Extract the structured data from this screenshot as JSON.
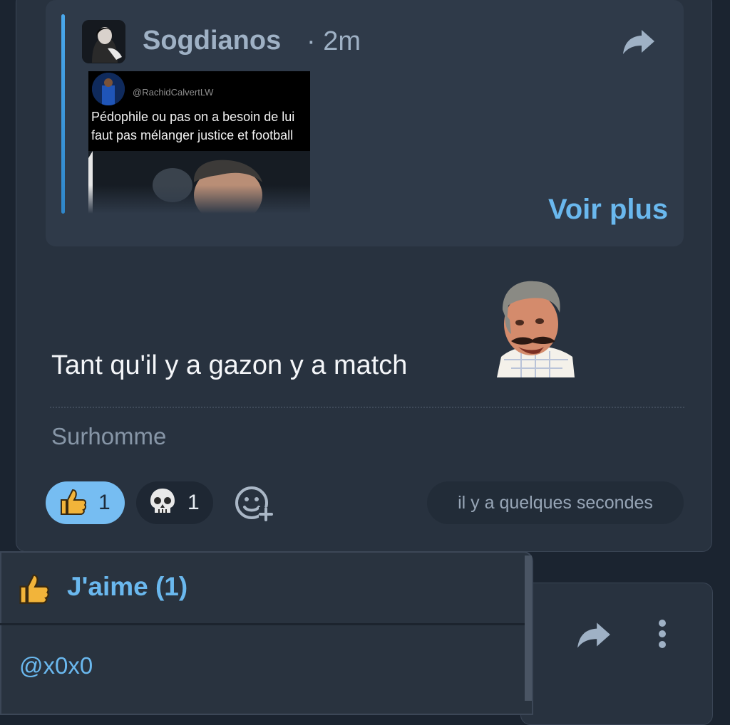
{
  "quoted_post": {
    "author": "Sogdianos",
    "time": "· 2m",
    "embed": {
      "handle": "@RachidCalvertLW",
      "lines": [
        "Pédophile ou pas on a besoin de lui",
        "faut pas mélanger justice et football"
      ]
    },
    "more_label": "Voir plus"
  },
  "comment": {
    "text": "Tant qu'il y a gazon y a match",
    "signature": "Surhomme"
  },
  "reactions": [
    {
      "icon": "thumbs-up-icon",
      "count": "1"
    },
    {
      "icon": "skull-icon",
      "count": "1"
    }
  ],
  "timestamp": "il y a quelques secondes",
  "likes_panel": {
    "title": "J'aime (1)",
    "users": [
      "@x0x0"
    ]
  },
  "colors": {
    "accent": "#6ab8ee",
    "card": "#28323f",
    "quote_bg": "#2f3a49",
    "like_pill": "#76bdf2"
  }
}
